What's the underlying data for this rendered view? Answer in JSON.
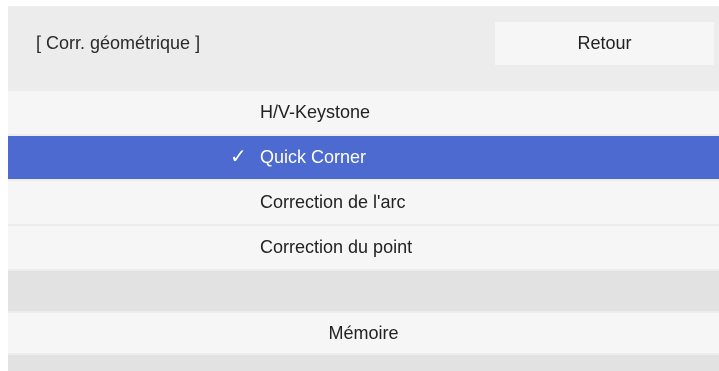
{
  "header": {
    "title": "[ Corr. géométrique ]",
    "back_label": "Retour"
  },
  "menu": {
    "items": [
      {
        "label": "H/V-Keystone",
        "selected": false
      },
      {
        "label": "Quick Corner",
        "selected": true,
        "check_glyph": "✓"
      },
      {
        "label": "Correction de l'arc",
        "selected": false
      },
      {
        "label": "Correction du point",
        "selected": false
      }
    ]
  },
  "memory": {
    "label": "Mémoire"
  },
  "colors": {
    "panel_background": "#ececec",
    "row_background": "#f6f6f6",
    "selected_background": "#4d6ad0",
    "selected_text": "#ffffff",
    "text": "#222222"
  },
  "icons": {
    "selected_marker": "check-icon"
  }
}
